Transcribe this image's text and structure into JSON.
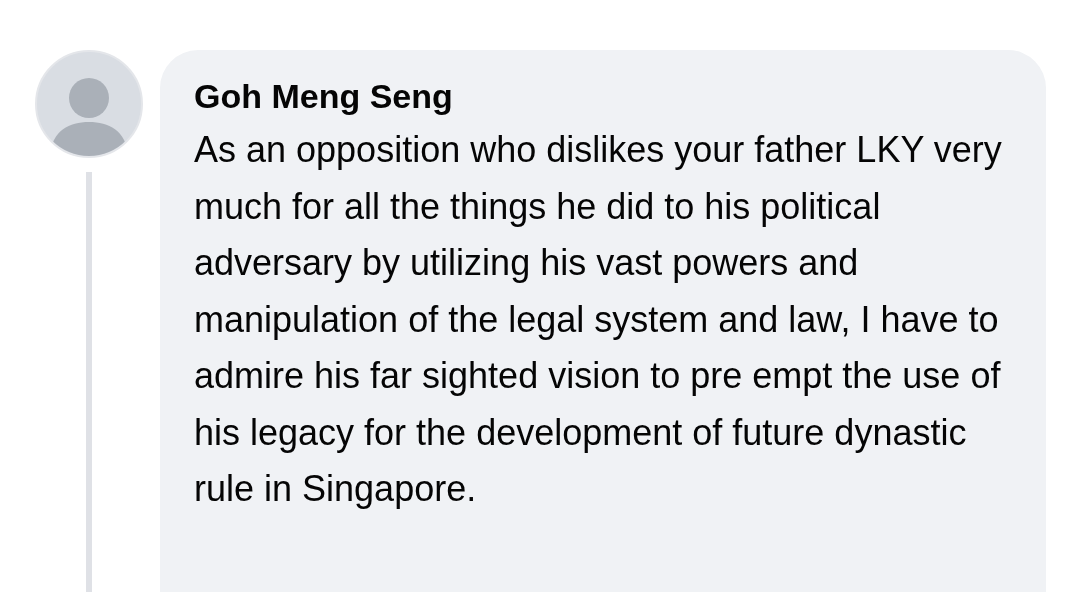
{
  "comment": {
    "author": "Goh Meng Seng",
    "text": "As an opposition who dislikes your father LKY very much for all the things he did to his political adversary by utilizing his vast powers and manipulation of the legal system and law, I have to admire his far sighted vision to pre empt the use of his legacy for the development of future dynastic rule in Singapore.",
    "has_replies": true
  }
}
